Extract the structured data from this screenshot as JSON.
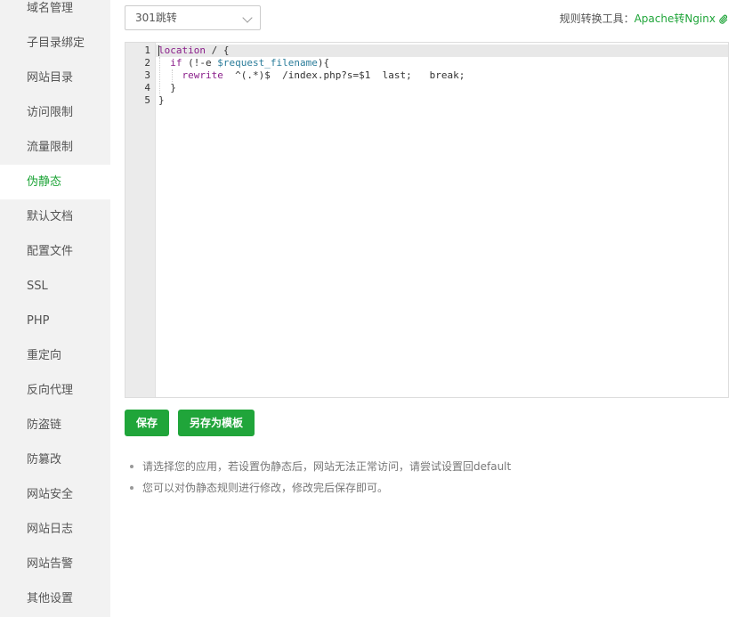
{
  "sidebar": {
    "items": [
      {
        "label": "域名管理"
      },
      {
        "label": "子目录绑定"
      },
      {
        "label": "网站目录"
      },
      {
        "label": "访问限制"
      },
      {
        "label": "流量限制"
      },
      {
        "label": "伪静态",
        "active": true
      },
      {
        "label": "默认文档"
      },
      {
        "label": "配置文件"
      },
      {
        "label": "SSL"
      },
      {
        "label": "PHP"
      },
      {
        "label": "重定向"
      },
      {
        "label": "反向代理"
      },
      {
        "label": "防盗链"
      },
      {
        "label": "防篡改"
      },
      {
        "label": "网站安全"
      },
      {
        "label": "网站日志"
      },
      {
        "label": "网站告警"
      },
      {
        "label": "其他设置"
      }
    ]
  },
  "toolbar": {
    "template_select_value": "301跳转",
    "tool_label": "规则转换工具：",
    "tool_link": "Apache转Nginx"
  },
  "editor": {
    "line_numbers": [
      "1",
      "2",
      "3",
      "4",
      "5"
    ],
    "lines": [
      "location / {",
      "  if (!-e $request_filename){",
      "    rewrite  ^(.*)$  /index.php?s=$1  last;   break;",
      "  }",
      "}"
    ]
  },
  "buttons": {
    "save": "保存",
    "save_as_template": "另存为模板"
  },
  "tips": [
    "请选择您的应用，若设置伪静态后，网站无法正常访问，请尝试设置回default",
    "您可以对伪静态规则进行修改，修改完后保存即可。"
  ],
  "colors": {
    "accent": "#20a53a",
    "sidebar_bg": "#f2f2f2"
  }
}
